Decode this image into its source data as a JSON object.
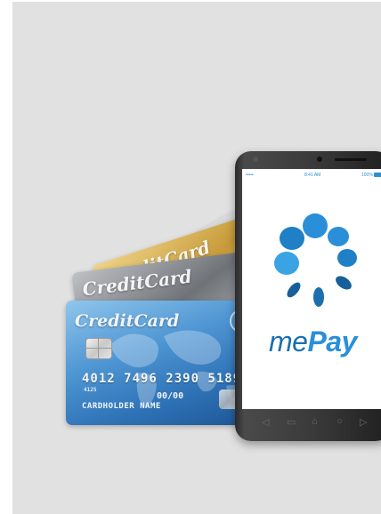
{
  "cards": {
    "silver": {
      "brand": "CreditCard"
    },
    "gold": {
      "brand": "CreditCard"
    },
    "gray": {
      "brand": "CreditCard"
    },
    "blue": {
      "brand": "CreditCard",
      "number": "4012 7496 2390 5189",
      "small_number": "4125",
      "expiry": "00/00",
      "holder": "CARDHOLDER NAME"
    }
  },
  "phone": {
    "status": {
      "signal": "••••• ",
      "time": "8:41 AM",
      "battery": "100%"
    },
    "app": {
      "name_prefix": "me",
      "name_bold": "Pay"
    },
    "nav_icons": [
      "back-icon",
      "recent-apps-icon",
      "home-icon",
      "search-icon",
      "forward-icon"
    ]
  },
  "colors": {
    "background": "#e1e1e1",
    "brand_blue_dark": "#1b6fae",
    "brand_blue_light": "#2a8fd8"
  }
}
